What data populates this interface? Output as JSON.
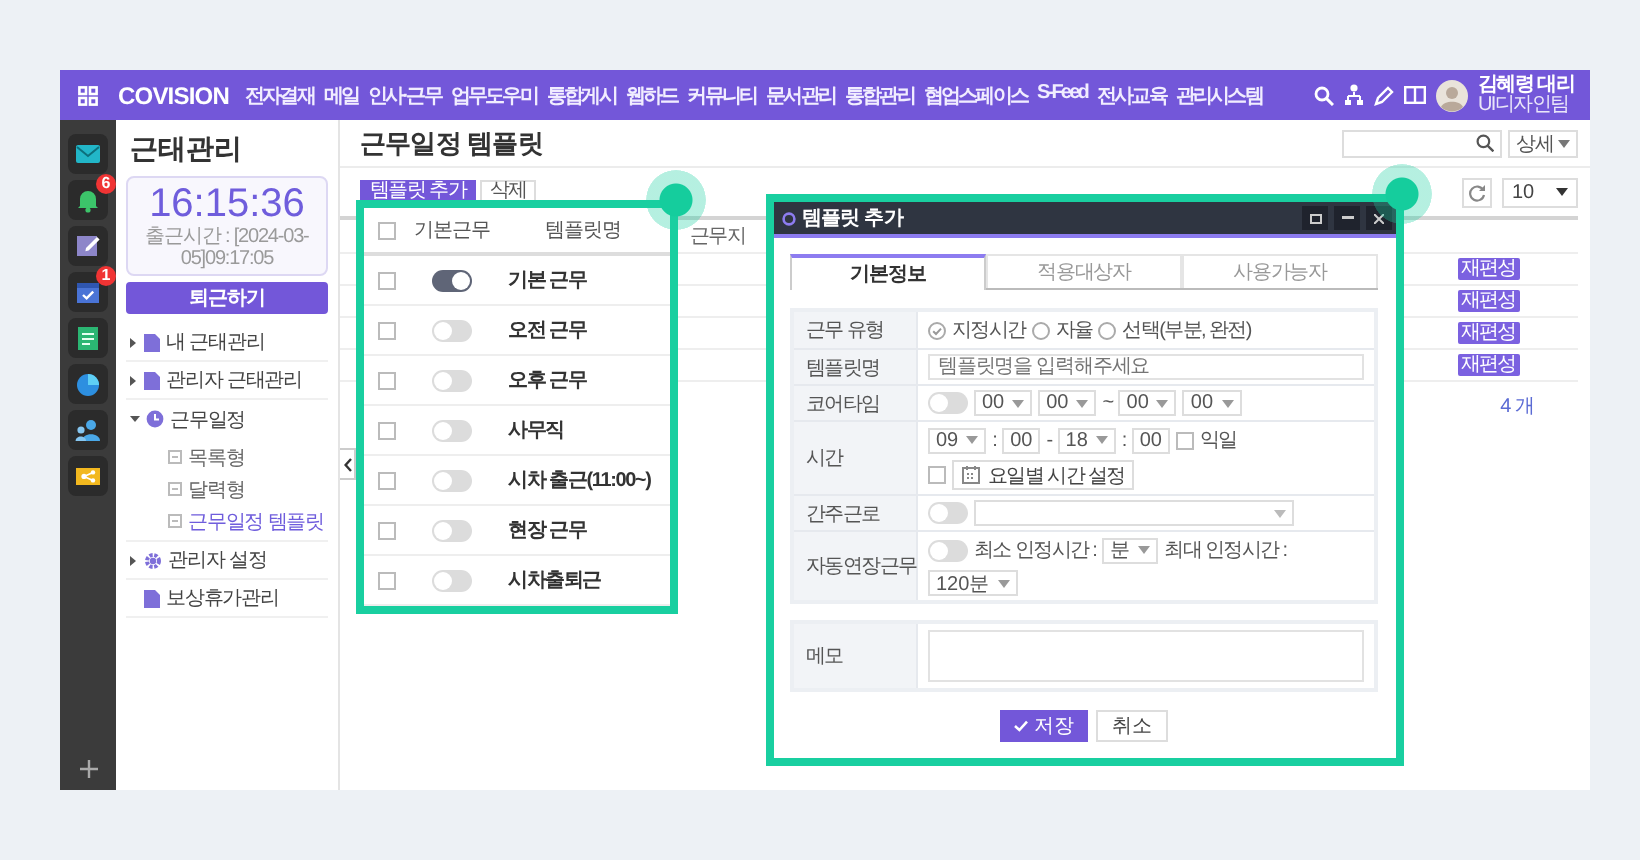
{
  "topbar": {
    "logo": "COVISION",
    "menu": [
      "전자결재",
      "메일",
      "인사·근무",
      "업무도우미",
      "통합게시",
      "웹하드",
      "커뮤니티",
      "문서관리",
      "통합관리",
      "협업스페이스",
      "S-Feed",
      "전사교육",
      "관리시스템"
    ],
    "user": {
      "name": "김혜령 대리",
      "team": "UI디자인팀"
    }
  },
  "rail": [
    {
      "kind": "mail"
    },
    {
      "kind": "bell",
      "badge": "6"
    },
    {
      "kind": "edit"
    },
    {
      "kind": "calendar",
      "badge": "1"
    },
    {
      "kind": "note"
    },
    {
      "kind": "chart"
    },
    {
      "kind": "people"
    },
    {
      "kind": "card"
    }
  ],
  "sidebar": {
    "title": "근태관리",
    "clock": "16:15:36",
    "clock_in": "출근시간 : [2024-03-05]09:17:05",
    "checkout_button": "퇴근하기",
    "items": [
      {
        "label": "내 근태관리",
        "kind": "doc",
        "expanded": false
      },
      {
        "label": "관리자 근태관리",
        "kind": "doc",
        "expanded": false
      },
      {
        "label": "근무일정",
        "kind": "clock",
        "expanded": true,
        "children": [
          {
            "label": "목록형",
            "selected": false
          },
          {
            "label": "달력형",
            "selected": false
          },
          {
            "label": "근무일정 템플릿",
            "selected": true
          }
        ]
      },
      {
        "label": "관리자 설정",
        "kind": "gear",
        "expanded": false
      },
      {
        "label": "보상휴가관리",
        "kind": "doc"
      }
    ]
  },
  "main": {
    "title": "근무일정 템플릿",
    "detail_button": "상세",
    "buttons": [
      "템플릿 추가",
      "삭제"
    ],
    "page_size": "10",
    "table": {
      "columns": [
        "근무지"
      ],
      "rows": [
        {
          "action": "재편성"
        },
        {
          "action": "재편성"
        },
        {
          "action": "재편성"
        },
        {
          "action": "재편성"
        }
      ],
      "count": "4 개"
    }
  },
  "callout": {
    "select_all": false,
    "columns": [
      "기본근무",
      "템플릿명"
    ],
    "rows": [
      {
        "name": "기본 근무",
        "default": true,
        "checked": false
      },
      {
        "name": "오전 근무",
        "default": false,
        "checked": false
      },
      {
        "name": "오후 근무",
        "default": false,
        "checked": false
      },
      {
        "name": "사무직",
        "default": false,
        "checked": false
      },
      {
        "name": "시차 출근(11:00~)",
        "default": false,
        "checked": false
      },
      {
        "name": "현장 근무",
        "default": false,
        "checked": false
      },
      {
        "name": "시차출퇴근",
        "default": false,
        "checked": false
      }
    ]
  },
  "modal": {
    "title": "템플릿 추가",
    "tabs": [
      {
        "label": "기본정보",
        "selected": true
      },
      {
        "label": "적용대상자",
        "selected": false
      },
      {
        "label": "사용가능자",
        "selected": false
      }
    ],
    "work_type": {
      "label": "근무 유형",
      "options": [
        {
          "label": "지정시간",
          "selected": true
        },
        {
          "label": "자율",
          "selected": false
        },
        {
          "label": "선택(부분, 완전)",
          "selected": false
        }
      ]
    },
    "name": {
      "label": "템플릿명",
      "placeholder": "템플릿명을 입력해주세요"
    },
    "core_time": {
      "label": "코어타임",
      "on": false,
      "start_hour": "00",
      "start_min": "00",
      "separator": "~",
      "end_hour": "00",
      "end_min": "00"
    },
    "time": {
      "label": "시간",
      "start_hour": "09",
      "start_min": "00",
      "end_hour": "18",
      "end_min": "00",
      "separators": [
        ":",
        "-",
        ":"
      ],
      "next_day": {
        "label": "익일",
        "checked": false
      },
      "per_day": {
        "label": "요일별 시간 설정",
        "checked": false
      }
    },
    "deemed": {
      "label": "간주근로",
      "on": false
    },
    "auto_extend": {
      "label": "자동연장근무",
      "on": false,
      "min_label": "최소 인정시간 :",
      "min_value": "분",
      "max_label": "최대 인정시간 :",
      "max_value": "120분"
    },
    "memo": {
      "label": "메모"
    },
    "buttons": {
      "save": "저장",
      "cancel": "취소"
    }
  }
}
